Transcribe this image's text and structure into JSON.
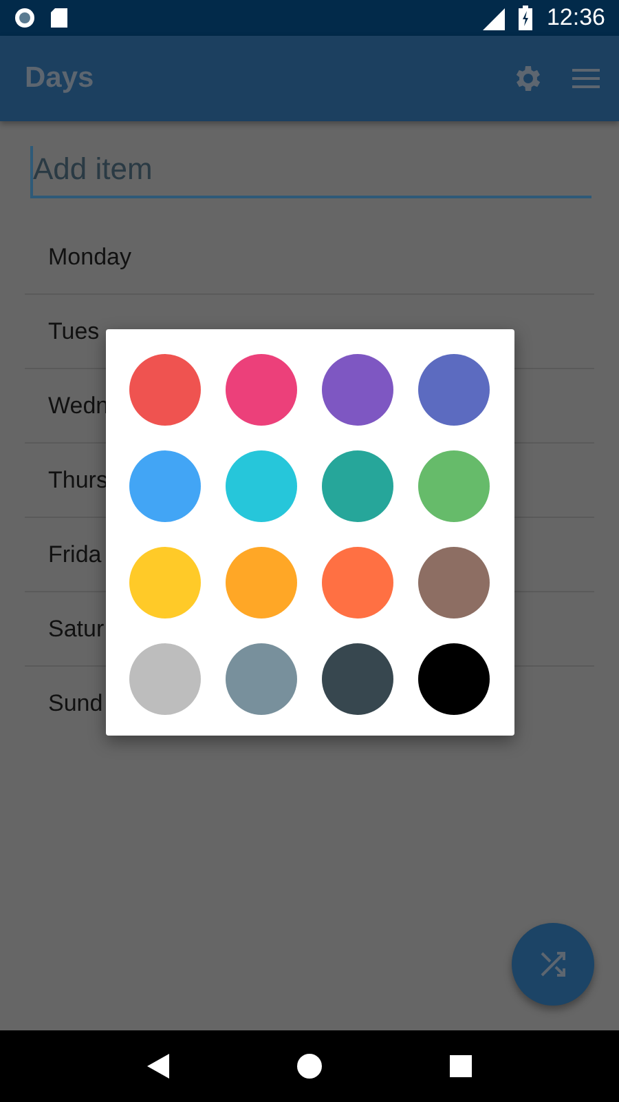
{
  "status_bar": {
    "time": "12:36"
  },
  "app_bar": {
    "title": "Days"
  },
  "add_field": {
    "placeholder": "Add item"
  },
  "items": [
    "Monday",
    "Tues",
    "Wedn",
    "Thurs",
    "Frida",
    "Satur",
    "Sund"
  ],
  "color_picker": {
    "swatches": [
      {
        "color": "#ef5350"
      },
      {
        "color": "#ec407a"
      },
      {
        "color": "#7e57c2"
      },
      {
        "color": "#5c6bc0"
      },
      {
        "color": "#42a5f5"
      },
      {
        "color": "#26c6da"
      },
      {
        "color": "#26a69a"
      },
      {
        "color": "#66bb6a"
      },
      {
        "color": "#ffca28"
      },
      {
        "color": "#ffa726"
      },
      {
        "color": "#ff7043"
      },
      {
        "color": "#8d6e63"
      },
      {
        "color": "#bdbdbd"
      },
      {
        "color": "#78909c"
      },
      {
        "color": "#37474f"
      },
      {
        "color": "#000000"
      }
    ]
  }
}
